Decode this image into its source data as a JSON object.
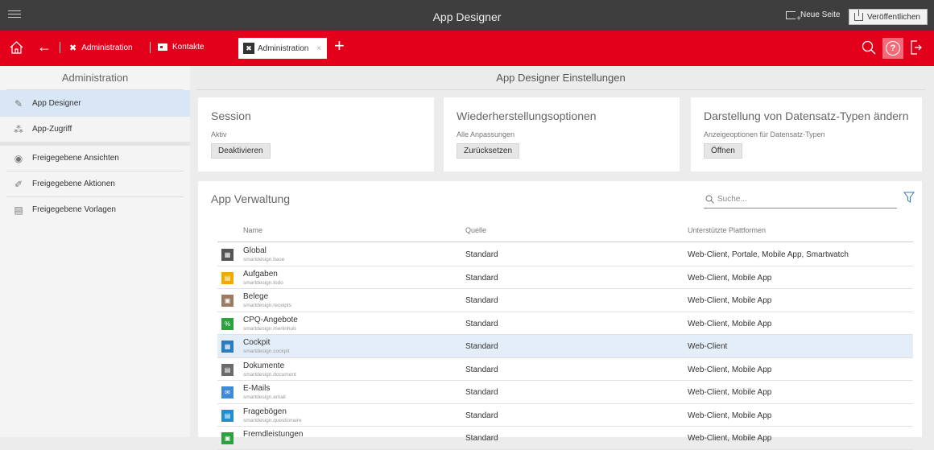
{
  "titlebar": {
    "title": "App Designer",
    "new_page": "Neue Seite",
    "publish": "Veröffentlichen"
  },
  "nav": {
    "crumbs": [
      {
        "label": "Administration",
        "icon": "tools-icon"
      },
      {
        "label": "Kontakte",
        "icon": "contact-card-icon"
      }
    ],
    "tab": {
      "label": "Administration",
      "close": "×"
    },
    "help": "?"
  },
  "sidebar": {
    "title": "Administration",
    "items": [
      {
        "label": "App Designer",
        "icon": "pencil-icon",
        "active": true
      },
      {
        "label": "App-Zugriff",
        "icon": "lock-icon"
      },
      {
        "label": "Freigegebene Ansichten",
        "icon": "eye-icon"
      },
      {
        "label": "Freigegebene Aktionen",
        "icon": "pen-icon"
      },
      {
        "label": "Freigegebene Vorlagen",
        "icon": "template-icon"
      }
    ]
  },
  "main": {
    "title": "App Designer Einstellungen",
    "cards": [
      {
        "title": "Session",
        "subtitle": "Aktiv",
        "button": "Deaktivieren"
      },
      {
        "title": "Wiederherstellungsoptionen",
        "subtitle": "Alle Anpassungen",
        "button": "Zurücksetzen"
      },
      {
        "title": "Darstellung von Datensatz-Typen ändern",
        "subtitle": "Anzeigeoptionen für Datensatz-Typen",
        "button": "Öffnen"
      }
    ],
    "apps": {
      "title": "App Verwaltung",
      "search_placeholder": "Suche...",
      "columns": {
        "name": "Name",
        "source": "Quelle",
        "platforms": "Unterstützte Plattformen"
      },
      "rows": [
        {
          "name": "Global",
          "id": "smartdesign.base",
          "source": "Standard",
          "platforms": "Web-Client, Portale, Mobile App, Smartwatch",
          "color": "#555555",
          "glyph": "▦"
        },
        {
          "name": "Aufgaben",
          "id": "smartdesign.todo",
          "source": "Standard",
          "platforms": "Web-Client, Mobile App",
          "color": "#f2a900",
          "glyph": "▤"
        },
        {
          "name": "Belege",
          "id": "smartdesign.receipts",
          "source": "Standard",
          "platforms": "Web-Client, Mobile App",
          "color": "#9a7b62",
          "glyph": "▣"
        },
        {
          "name": "CPQ-Angebote",
          "id": "smartdesign.merlinhub",
          "source": "Standard",
          "platforms": "Web-Client, Mobile App",
          "color": "#2aa33e",
          "glyph": "%"
        },
        {
          "name": "Cockpit",
          "id": "smartdesign.cockpit",
          "source": "Standard",
          "platforms": "Web-Client",
          "color": "#2b7bc0",
          "glyph": "▦",
          "selected": true
        },
        {
          "name": "Dokumente",
          "id": "smartdesign.document",
          "source": "Standard",
          "platforms": "Web-Client, Mobile App",
          "color": "#6b6b6b",
          "glyph": "▤"
        },
        {
          "name": "E-Mails",
          "id": "smartdesign.email",
          "source": "Standard",
          "platforms": "Web-Client, Mobile App",
          "color": "#3f8ad6",
          "glyph": "✉"
        },
        {
          "name": "Fragebögen",
          "id": "smartdesign.questionaire",
          "source": "Standard",
          "platforms": "Web-Client, Mobile App",
          "color": "#1e8fd0",
          "glyph": "▤"
        },
        {
          "name": "Fremdleistungen",
          "id": "",
          "source": "Standard",
          "platforms": "Web-Client, Mobile App",
          "color": "#2aa33e",
          "glyph": "▣"
        }
      ]
    }
  }
}
